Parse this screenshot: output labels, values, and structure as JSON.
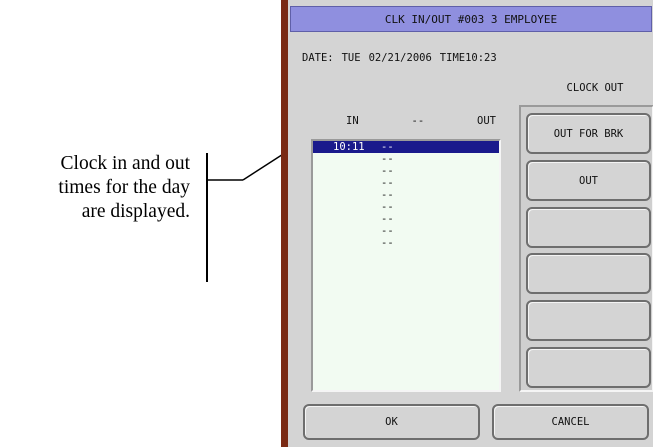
{
  "callout": {
    "line1": "Clock in and out",
    "line2": "times for the day",
    "line3": "are displayed."
  },
  "dialog": {
    "title": "CLK IN/OUT #003 3 EMPLOYEE",
    "date_label": "DATE:",
    "day": "TUE",
    "date": "02/21/2006",
    "time_label": "TIME",
    "time": "10:23",
    "clock_out_label": "CLOCK OUT",
    "columns": {
      "in": "IN",
      "sep": "--",
      "out": "OUT"
    },
    "rows": [
      {
        "in": "10:11",
        "sep": "--",
        "out": ""
      },
      {
        "in": "",
        "sep": "--",
        "out": ""
      },
      {
        "in": "",
        "sep": "--",
        "out": ""
      },
      {
        "in": "",
        "sep": "--",
        "out": ""
      },
      {
        "in": "",
        "sep": "--",
        "out": ""
      },
      {
        "in": "",
        "sep": "--",
        "out": ""
      },
      {
        "in": "",
        "sep": "--",
        "out": ""
      },
      {
        "in": "",
        "sep": "--",
        "out": ""
      },
      {
        "in": "",
        "sep": "--",
        "out": ""
      }
    ],
    "side_buttons": [
      "OUT FOR BRK",
      "OUT",
      "",
      "",
      "",
      ""
    ],
    "ok_label": "OK",
    "cancel_label": "CANCEL"
  },
  "colors": {
    "title_bar": "#8f8fdf",
    "selection": "#1a1a8c",
    "list_background": "#f2fbf2",
    "dialog_background": "#d4d4d4"
  }
}
